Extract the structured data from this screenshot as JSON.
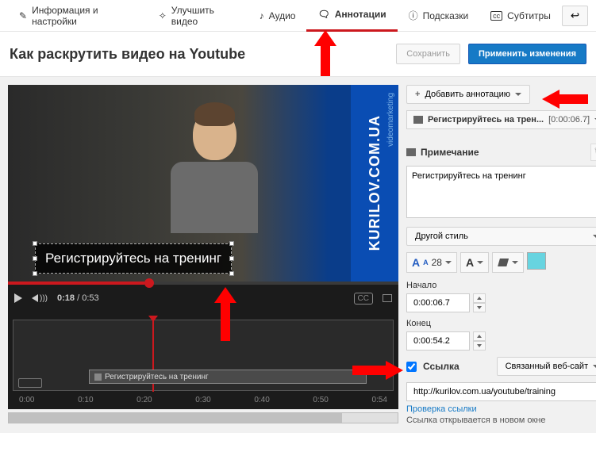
{
  "tabs": {
    "info": "Информация и настройки",
    "improve": "Улучшить видео",
    "audio": "Аудио",
    "annotations": "Аннотации",
    "cards": "Подсказки",
    "subtitles": "Субтитры"
  },
  "header": {
    "title": "Как раскрутить видео на Youtube",
    "save": "Сохранить",
    "apply": "Применить изменения"
  },
  "video": {
    "annotation_text": "Регистрируйтесь на тренинг",
    "banner": "KURILOV.COM.UA",
    "banner_sub": "videomarketing",
    "current": "0:18",
    "total": "0:53",
    "cc": "CC"
  },
  "timeline": {
    "clip_label": "Регистрируйтесь на тренинг",
    "ticks": [
      "0:00",
      "0:10",
      "0:20",
      "0:30",
      "0:40",
      "0:50",
      "0:54"
    ]
  },
  "panel": {
    "add_label": "Добавить аннотацию",
    "list_item": {
      "text": "Регистрируйтесь на трен...",
      "time": "[0:00:06.7]"
    },
    "note_header": "Примечание",
    "note_text": "Регистрируйтесь на тренинг",
    "style": "Другой стиль",
    "font_size": "28",
    "start_label": "Начало",
    "start_val": "0:00:06.7",
    "end_label": "Конец",
    "end_val": "0:00:54.2",
    "link_label": "Ссылка",
    "link_type": "Связанный веб-сайт",
    "url": "http://kurilov.com.ua/youtube/training",
    "link_check": "Проверка ссылки",
    "link_note": "Ссылка открывается в новом окне"
  }
}
